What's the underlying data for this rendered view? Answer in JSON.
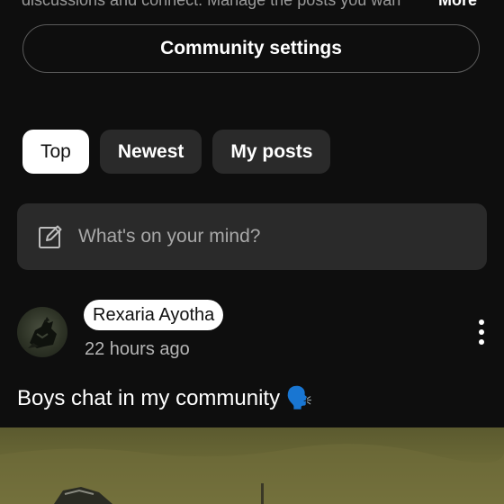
{
  "about": {
    "clipped_text": "discussions and connect. Manage the posts you wan",
    "more_label": "More"
  },
  "settings_button": {
    "label": "Community settings"
  },
  "filters": [
    {
      "label": "Top",
      "active": true
    },
    {
      "label": "Newest",
      "active": false
    },
    {
      "label": "My posts",
      "active": false
    }
  ],
  "composer": {
    "placeholder": "What's on your mind?",
    "icon": "edit-icon"
  },
  "post": {
    "author": "Rexaria Ayotha",
    "time": "22 hours ago",
    "text": "Boys chat in my community 🗣️",
    "menu_icon": "more-vertical-icon"
  },
  "colors": {
    "background": "#0e0e0e",
    "surface": "#2a2a2a",
    "active_chip": "#ffffff",
    "muted_text": "#a8a8a8"
  }
}
